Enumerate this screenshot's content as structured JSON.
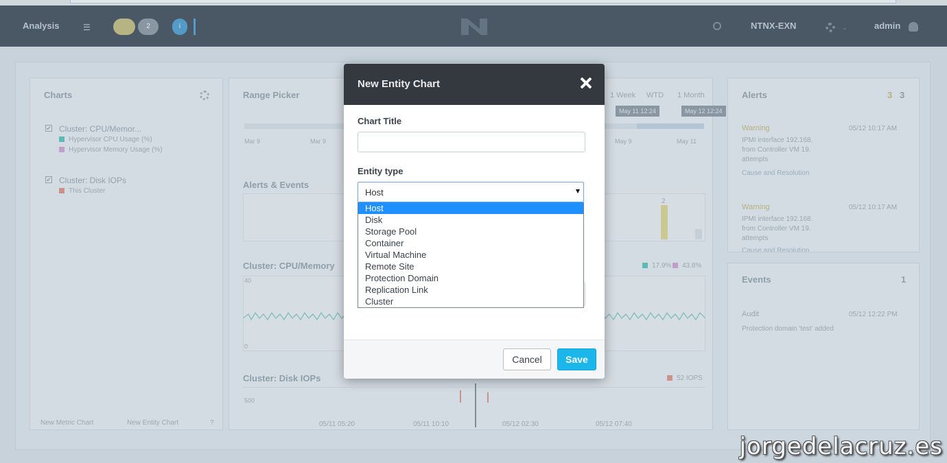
{
  "topbar": {
    "app_section": "Analysis",
    "pill_1": "",
    "pill_2": "2",
    "pill_3": "i",
    "cluster_name": "NTNX-EXN",
    "user": "admin"
  },
  "charts_panel": {
    "title": "Charts",
    "items": [
      {
        "name": "Cluster: CPU/Memor...",
        "metrics": [
          "Hypervisor CPU Usage (%)",
          "Hypervisor Memory Usage (%)"
        ]
      },
      {
        "name": "Cluster: Disk IOPs",
        "metrics": [
          "This Cluster"
        ]
      }
    ],
    "footer_new_metric": "New Metric Chart",
    "footer_new_entity": "New Entity Chart",
    "footer_help": "?"
  },
  "range_picker": {
    "title": "Range Picker",
    "options": [
      "1 Week",
      "WTD",
      "1 Month"
    ],
    "handle_start": "May 11 12:24",
    "handle_end": "May 12 12:24",
    "scale_start": "Mar 9",
    "scale_mid": "Mar 9",
    "scale_a": "May 9",
    "scale_b": "May 11"
  },
  "alerts_events_chart": {
    "title": "Alerts & Events",
    "bar_label": "2"
  },
  "cpu_chart": {
    "title": "Cluster: CPU/Memory",
    "y_top": "40",
    "y_bottom": "0",
    "legend_1": "17.9%",
    "legend_2": "43.8%"
  },
  "disk_chart": {
    "title": "Cluster: Disk IOPs",
    "y_label": "500",
    "legend": "52 IOPS",
    "x_ticks": [
      "05/11 05:20",
      "05/11 10:10",
      "05/12 02:30",
      "05/12 07:40"
    ]
  },
  "alerts_panel": {
    "title": "Alerts",
    "count_warn": "3",
    "count_total": "3",
    "items": [
      {
        "level": "Warning",
        "time": "05/12 10:17 AM",
        "text_1": "IPMI interface 192.168.",
        "text_2": "from Controller VM 19.",
        "text_3": "attempts",
        "link": "Cause and Resolution"
      },
      {
        "level": "Warning",
        "time": "05/12 10:17 AM",
        "text_1": "IPMI interface 192.168.",
        "text_2": "from Controller VM 19.",
        "text_3": "attempts",
        "link": "Cause and Resolution"
      }
    ]
  },
  "events_panel": {
    "title": "Events",
    "count": "1",
    "item_level": "Audit",
    "item_time": "05/12 12:22 PM",
    "item_text": "Protection domain 'test' added"
  },
  "modal": {
    "title": "New Entity Chart",
    "chart_title_label": "Chart Title",
    "chart_title_value": "",
    "entity_type_label": "Entity type",
    "entity_type_selected": "Host",
    "entity_options": [
      "Host",
      "Disk",
      "Storage Pool",
      "Container",
      "Virtual Machine",
      "Remote Site",
      "Protection Domain",
      "Replication Link",
      "Cluster"
    ],
    "cancel_label": "Cancel",
    "save_label": "Save"
  },
  "watermark": "jorgedelacruz.es",
  "colors": {
    "modal_header": "#34393f",
    "save_button": "#1bb7ea",
    "dropdown_highlight": "#1e90ff",
    "cpu_series": "#5cc6bb",
    "memory_series": "#d6a5d8",
    "disk_series": "#e79184"
  }
}
